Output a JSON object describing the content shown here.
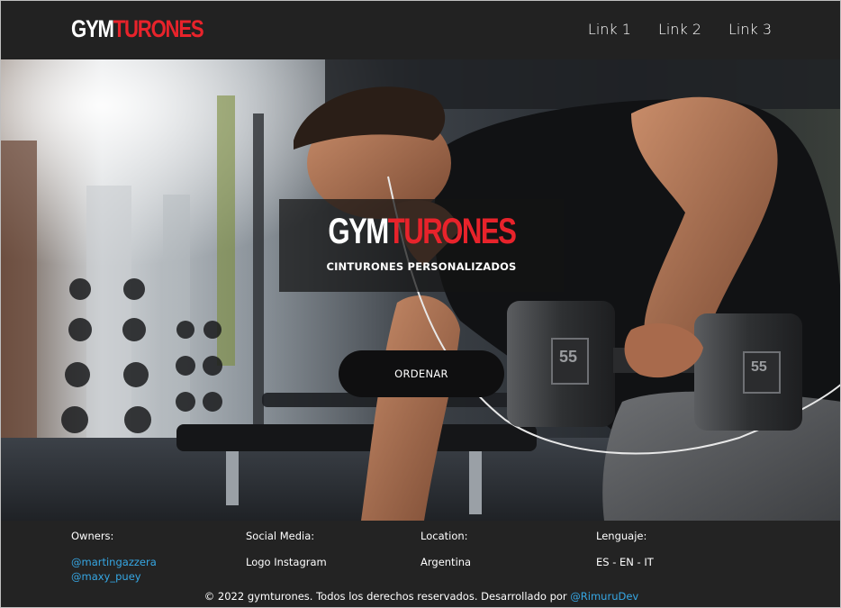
{
  "navbar": {
    "logo_part1": "GYM",
    "logo_part2": "TURONES",
    "links": [
      "Link 1",
      "Link 2",
      "Link 3"
    ]
  },
  "hero": {
    "logo_part1": "GYM",
    "logo_part2": "TURONES",
    "subtitle": "CINTURONES PERSONALIZADOS",
    "order_label": "ORDENAR",
    "dumbbell_weight": "55"
  },
  "footer": {
    "owners": {
      "title": "Owners:",
      "links": [
        "@martingazzera",
        "@maxy_puey"
      ]
    },
    "social": {
      "title": "Social Media:",
      "value": "Logo Instagram"
    },
    "location": {
      "title": "Location:",
      "value": "Argentina"
    },
    "language": {
      "title": "Lenguaje:",
      "value": "ES - EN - IT"
    },
    "copyright_text": "© 2022 gymturones. Todos los derechos reservados. Desarrollado por",
    "developer": "@RimuruDev"
  },
  "colors": {
    "brand_red": "#e8232b",
    "link_blue": "#36a7e4",
    "dark": "#222222"
  }
}
